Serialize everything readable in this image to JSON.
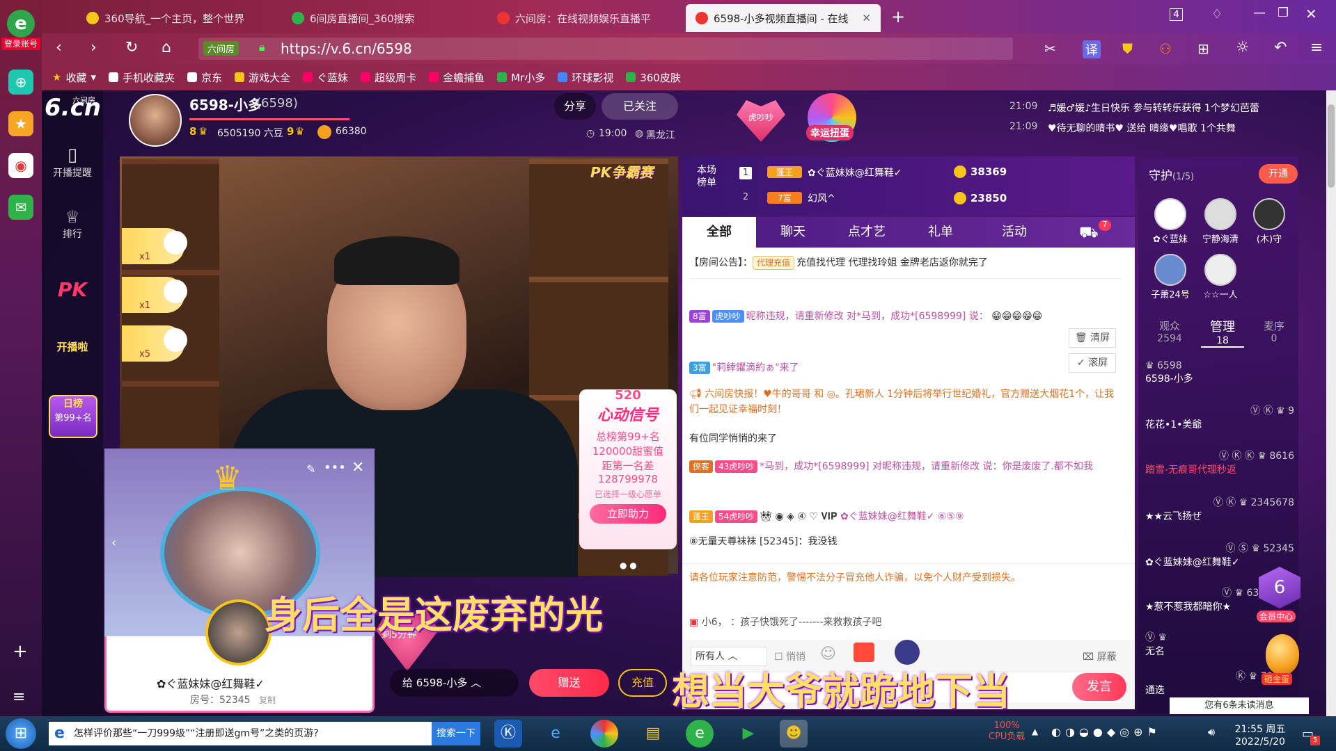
{
  "browser": {
    "tabs": [
      {
        "label": "360导航_一个主页，整个世界"
      },
      {
        "label": "6间房直播间_360搜索"
      },
      {
        "label": "六间房：在线视频娱乐直播平"
      },
      {
        "label": "6598-小多视频直播间 - 在线"
      }
    ],
    "url": "https://v.6.cn/6598",
    "url_hint": "六间房",
    "login_label": "登录账号",
    "tab_count": "4",
    "bookmarks": [
      "收藏",
      "手机收藏夹",
      "京东",
      "游戏大全",
      "ぐ蓝妹",
      "超级周卡",
      "金蟾捕鱼",
      "Mr小多",
      "环球影视",
      "360皮肤"
    ]
  },
  "site": {
    "logo_text": "6.cn",
    "logo_sub": "六间房",
    "nav": [
      "开播提醒",
      "排行",
      "PK",
      "开播啦"
    ],
    "daily_rank_label": "日榜",
    "daily_rank_value": "第99+名"
  },
  "anchor": {
    "name": "6598-小多",
    "room": "(6598)",
    "beans": "6505190 六豆",
    "level_left": "8",
    "level_right": "9",
    "coins": "66380",
    "time": "19:00",
    "location": "黑龙江",
    "share": "分享",
    "followed": "已关注"
  },
  "promo": {
    "badge": "虎吵吵",
    "lucky": "幸运扭蛋",
    "feed": [
      {
        "time": "21:09",
        "text": "♬媛♂媛♪生日快乐 参与转转乐获得 1个梦幻芭蕾"
      },
      {
        "time": "21:09",
        "text": "♥待无聊的晴书♥ 送给 晴缘♥唱歌 1个共舞"
      }
    ]
  },
  "video": {
    "pk_label": "PK争霸赛",
    "gifts": [
      {
        "count": "x1"
      },
      {
        "count": "x1"
      },
      {
        "count": "x5"
      }
    ],
    "event": {
      "title": "520",
      "subtitle": "心动信号",
      "rank": "总榜第99+名",
      "sweet": "120000甜蜜值",
      "gap_label": "距第一名差",
      "gap": "128799978",
      "selected": "已选择一级心愿单",
      "cta": "立即助力"
    },
    "subtitle_top": "身后全是这废弃的光",
    "subtitle_bottom": "想当大爷就跪地下当",
    "timer": "剩5分钟",
    "overlay": {
      "name": "✿ぐ蓝妹妹@红舞鞋✓",
      "room": "房号：52345",
      "copy": "复制"
    }
  },
  "gift_bar": {
    "to": "6598-小多",
    "give": "赠送",
    "recharge": "充值"
  },
  "rank": {
    "label": "本场榜单",
    "rows": [
      {
        "n": "1",
        "badge": "蓬王",
        "name": "✿ぐ蓝妹妹@红舞鞋✓",
        "coins": "38369"
      },
      {
        "n": "2",
        "badge": "7富",
        "name": "幻风^",
        "coins": "23850"
      }
    ]
  },
  "chat": {
    "tabs": [
      "全部",
      "聊天",
      "点才艺",
      "礼单",
      "活动"
    ],
    "cart_badge": "7",
    "notice_label": "【房间公告】：",
    "notice_tag": "代理充值",
    "notice": "充值找代理 代理找玲姐 金牌老店返你就完了",
    "clear": "清屏",
    "scroll": "滚屏",
    "messages": [
      {
        "badge": "8富",
        "badge2": "虎吵吵",
        "text": "昵称违规，请重新修改 对*马到，成功*[6598999] 说："
      },
      {
        "badge": "3富",
        "badge2": "",
        "text": "\"莉緈鑺滴約ぁ\"来了"
      },
      {
        "badge": "",
        "badge2": "",
        "text": "六间房快报！♥牛的哥哥 和 ◎。孔珺新人 1分钟后将举行世纪婚礼，官方赠送大烟花1个，让我们一起见证幸福时刻！"
      },
      {
        "badge": "",
        "badge2": "",
        "text": "有位同学悄悄的来了"
      },
      {
        "badge": "侠客",
        "badge2": "43虎吵吵",
        "text": "*马到，成功*[6598999] 对昵称违规，请重新修改 说：你是废废了.都不如我"
      },
      {
        "badge": "蓬王",
        "badge2": "54虎吵吵",
        "text": "✿ぐ蓝妹妹@红舞鞋✓ ⑥⑤⑨"
      },
      {
        "badge": "",
        "badge2": "",
        "text": "⑧无量天尊袜袜 [52345]：我没钱"
      }
    ],
    "warning": "请各位玩家注意防范，警惕不法分子冒充他人诈骗，以免个人财产受到损失。",
    "last_msg": "小6， ：孩子快饿死了-------来救救孩子吧",
    "input": {
      "target": "所有人",
      "whisper": "悄悄",
      "shield": "屏蔽",
      "send": "发言"
    }
  },
  "guard": {
    "title": "守护",
    "count": "(1/5)",
    "open": "开通",
    "members": [
      "✿ぐ蓝妹",
      "宁静海清",
      "(木)守",
      "子萧24号",
      "☆☆一人"
    ],
    "stats": [
      {
        "label": "观众",
        "value": "2594"
      },
      {
        "label": "管理",
        "value": "18"
      },
      {
        "label": "麦序",
        "value": "0"
      }
    ],
    "list": [
      {
        "tag": "6598",
        "name": "6598-小多"
      },
      {
        "tag": "9",
        "name": "花花•1•美爺"
      },
      {
        "tag": "8616",
        "name": "踏雪-无痕哥代理秒返"
      },
      {
        "tag": "2345678",
        "name": "★★云飞扬ぜ"
      },
      {
        "tag": "52345",
        "name": "✿ぐ蓝妹妹@红舞鞋✓"
      },
      {
        "tag": "6333100",
        "name": "★惹不惹我都暗你★"
      },
      {
        "tag": "",
        "name": "无名"
      },
      {
        "tag": "70777",
        "name": "通迭"
      }
    ],
    "member_center": "会员中心",
    "egg": "砸金蛋",
    "unread": "您有6条未读消息"
  },
  "taskbar": {
    "search_text": "怎样评价那些“一刀999级”“注册即送gm号”之类的页游?",
    "search_btn": "搜索一下",
    "cpu": "100%",
    "cpu_label": "CPU负载",
    "time": "21:55 周五",
    "date": "2022/5/20",
    "notif": "5"
  }
}
